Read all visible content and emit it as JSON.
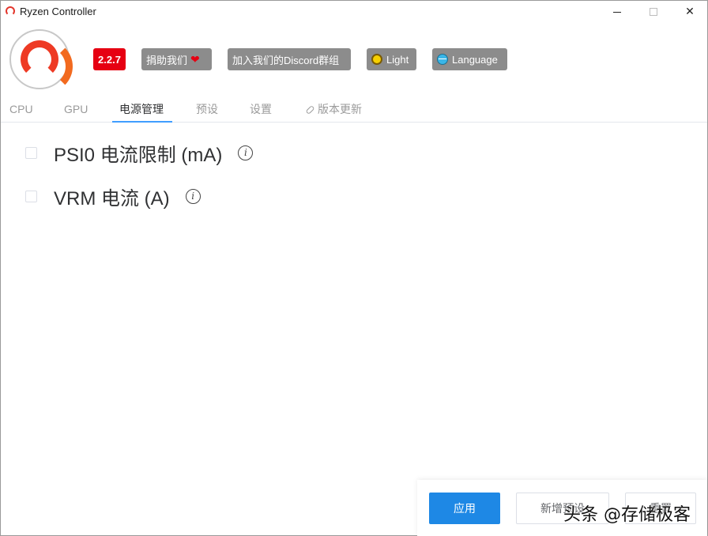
{
  "window": {
    "title": "Ryzen Controller",
    "minimize_icon": "minimize-icon",
    "maximize_icon": "maximize-icon",
    "close_icon": "close-icon",
    "close_glyph": "✕"
  },
  "header": {
    "logo_icon": "ryzen-controller-logo",
    "version": "2.2.7",
    "donate_label": "捐助我们",
    "donate_icon": "heart-icon",
    "heart_glyph": "❤",
    "discord_label": "加入我们的Discord群组",
    "theme_label": "Light",
    "theme_icon": "sun-icon",
    "language_label": "Language",
    "language_icon": "globe-icon"
  },
  "tabs": [
    {
      "label": "CPU",
      "active": false
    },
    {
      "label": "GPU",
      "active": false
    },
    {
      "label": "电源管理",
      "active": true
    },
    {
      "label": "预设",
      "active": false
    },
    {
      "label": "设置",
      "active": false
    },
    {
      "label": "版本更新",
      "active": false,
      "icon": "link-icon"
    }
  ],
  "options": [
    {
      "label": "PSI0 电流限制 (mA)",
      "checked": false,
      "info_icon": "info-icon",
      "info_glyph": "i"
    },
    {
      "label": "VRM 电流 (A)",
      "checked": false,
      "info_icon": "info-icon",
      "info_glyph": "i"
    }
  ],
  "footer": {
    "apply_label": "应用",
    "new_preset_label": "新增预设",
    "reset_label": "重置"
  },
  "watermark": "头条 @存储极客",
  "colors": {
    "accent": "#409eff",
    "apply_button": "#1e88e5",
    "version_badge": "#e60012",
    "header_button": "#8c8c8c",
    "logo": "#ee3a24"
  }
}
